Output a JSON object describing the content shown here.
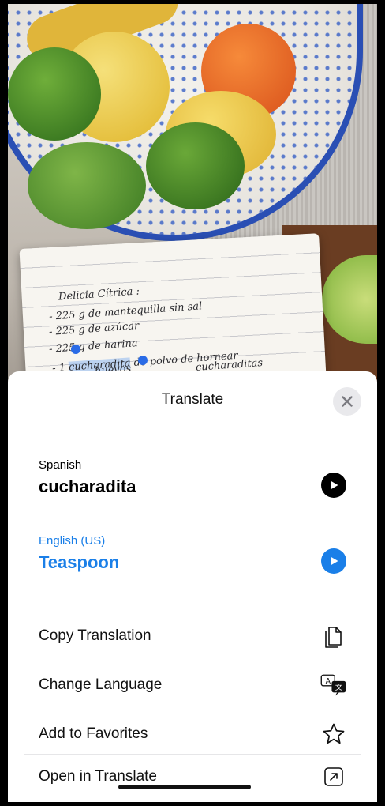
{
  "photo": {
    "notebook_lines": [
      "Delicia Cítrica :",
      "- 225 g de mantequilla sin sal",
      "- 225 g de azúcar",
      "- 225 g de harina",
      "- 1",
      "cucharadita",
      "de polvo de hornear",
      "huevos",
      "cucharaditas"
    ]
  },
  "sheet": {
    "title": "Translate",
    "source": {
      "language": "Spanish",
      "text": "cucharadita"
    },
    "target": {
      "language": "English (US)",
      "text": "Teaspoon"
    },
    "actions": [
      {
        "label": "Copy Translation",
        "icon": "copy-icon"
      },
      {
        "label": "Change Language",
        "icon": "translate-language-icon"
      },
      {
        "label": "Add to Favorites",
        "icon": "star-icon"
      },
      {
        "label": "Open in Translate",
        "icon": "open-external-icon"
      }
    ]
  },
  "colors": {
    "accent": "#1a7fe8",
    "close_bg": "#e9e9ec",
    "text": "#111111"
  }
}
